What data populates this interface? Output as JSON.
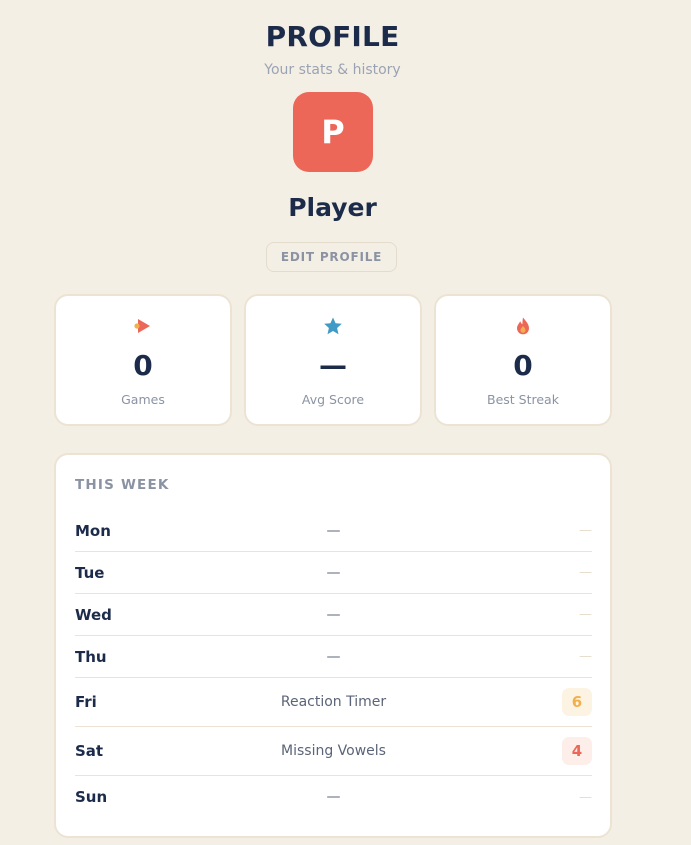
{
  "header": {
    "title": "PROFILE",
    "subtitle": "Your stats & history"
  },
  "profile": {
    "avatar_letter": "P",
    "avatar_color": "#ed6759",
    "name": "Player",
    "edit_label": "EDIT PROFILE"
  },
  "stats": [
    {
      "icon": "play-icon",
      "value": "0",
      "label": "Games"
    },
    {
      "icon": "star-icon",
      "value": "—",
      "label": "Avg Score"
    },
    {
      "icon": "flame-icon",
      "value": "0",
      "label": "Best Streak"
    }
  ],
  "week": {
    "title": "THIS WEEK",
    "days": [
      {
        "day": "Mon",
        "game": "—",
        "score": "—"
      },
      {
        "day": "Tue",
        "game": "—",
        "score": "—"
      },
      {
        "day": "Wed",
        "game": "—",
        "score": "—"
      },
      {
        "day": "Thu",
        "game": "—",
        "score": "—"
      },
      {
        "day": "Fri",
        "game": "Reaction Timer",
        "score": "6",
        "score_color": "#f2b04d",
        "score_bg": "#fdf3e3"
      },
      {
        "day": "Sat",
        "game": "Missing Vowels",
        "score": "4",
        "score_color": "#ed6759",
        "score_bg": "#fdeee9"
      },
      {
        "day": "Sun",
        "game": "—",
        "score": "—"
      }
    ]
  },
  "colors": {
    "background": "#f4efe5",
    "accent": "#ed6759",
    "text": "#1d2b4b",
    "muted": "#8b93a3"
  }
}
